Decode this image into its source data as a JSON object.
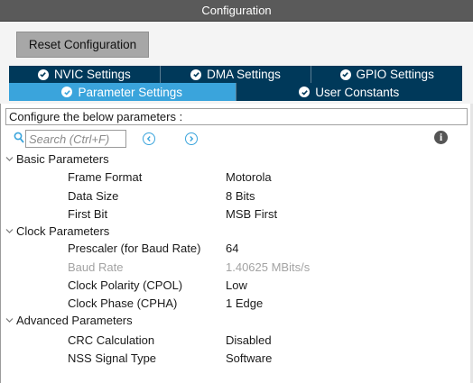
{
  "window": {
    "title": "Configuration"
  },
  "toolbar": {
    "reset_label": "Reset Configuration"
  },
  "tabs_row1": [
    {
      "label": "NVIC Settings",
      "icon": "check-circle-icon"
    },
    {
      "label": "DMA Settings",
      "icon": "check-circle-icon"
    },
    {
      "label": "GPIO Settings",
      "icon": "check-circle-icon"
    }
  ],
  "tabs_row2": [
    {
      "label": "Parameter Settings",
      "icon": "check-circle-icon",
      "active": true
    },
    {
      "label": "User Constants",
      "icon": "check-circle-icon",
      "active": false
    }
  ],
  "description": "Configure the below parameters :",
  "search": {
    "placeholder": "Search (Ctrl+F)",
    "value": ""
  },
  "colors": {
    "tab_dark": "#00395a",
    "tab_active": "#3aa4dc",
    "title_bar": "#5a5a5a",
    "disabled_text": "#a3a3a3"
  },
  "groups": [
    {
      "label": "Basic Parameters",
      "expanded": true,
      "params": [
        {
          "name": "Frame Format",
          "value": "Motorola",
          "disabled": false
        },
        {
          "name": "Data Size",
          "value": "8 Bits",
          "disabled": false
        },
        {
          "name": "First Bit",
          "value": "MSB First",
          "disabled": false
        }
      ]
    },
    {
      "label": "Clock Parameters",
      "expanded": true,
      "params": [
        {
          "name": "Prescaler (for Baud Rate)",
          "value": "64",
          "disabled": false
        },
        {
          "name": "Baud Rate",
          "value": "1.40625 MBits/s",
          "disabled": true
        },
        {
          "name": "Clock Polarity (CPOL)",
          "value": "Low",
          "disabled": false
        },
        {
          "name": "Clock Phase (CPHA)",
          "value": "1 Edge",
          "disabled": false
        }
      ]
    },
    {
      "label": "Advanced Parameters",
      "expanded": true,
      "params": [
        {
          "name": "CRC Calculation",
          "value": "Disabled",
          "disabled": false
        },
        {
          "name": "NSS Signal Type",
          "value": "Software",
          "disabled": false
        }
      ]
    }
  ]
}
